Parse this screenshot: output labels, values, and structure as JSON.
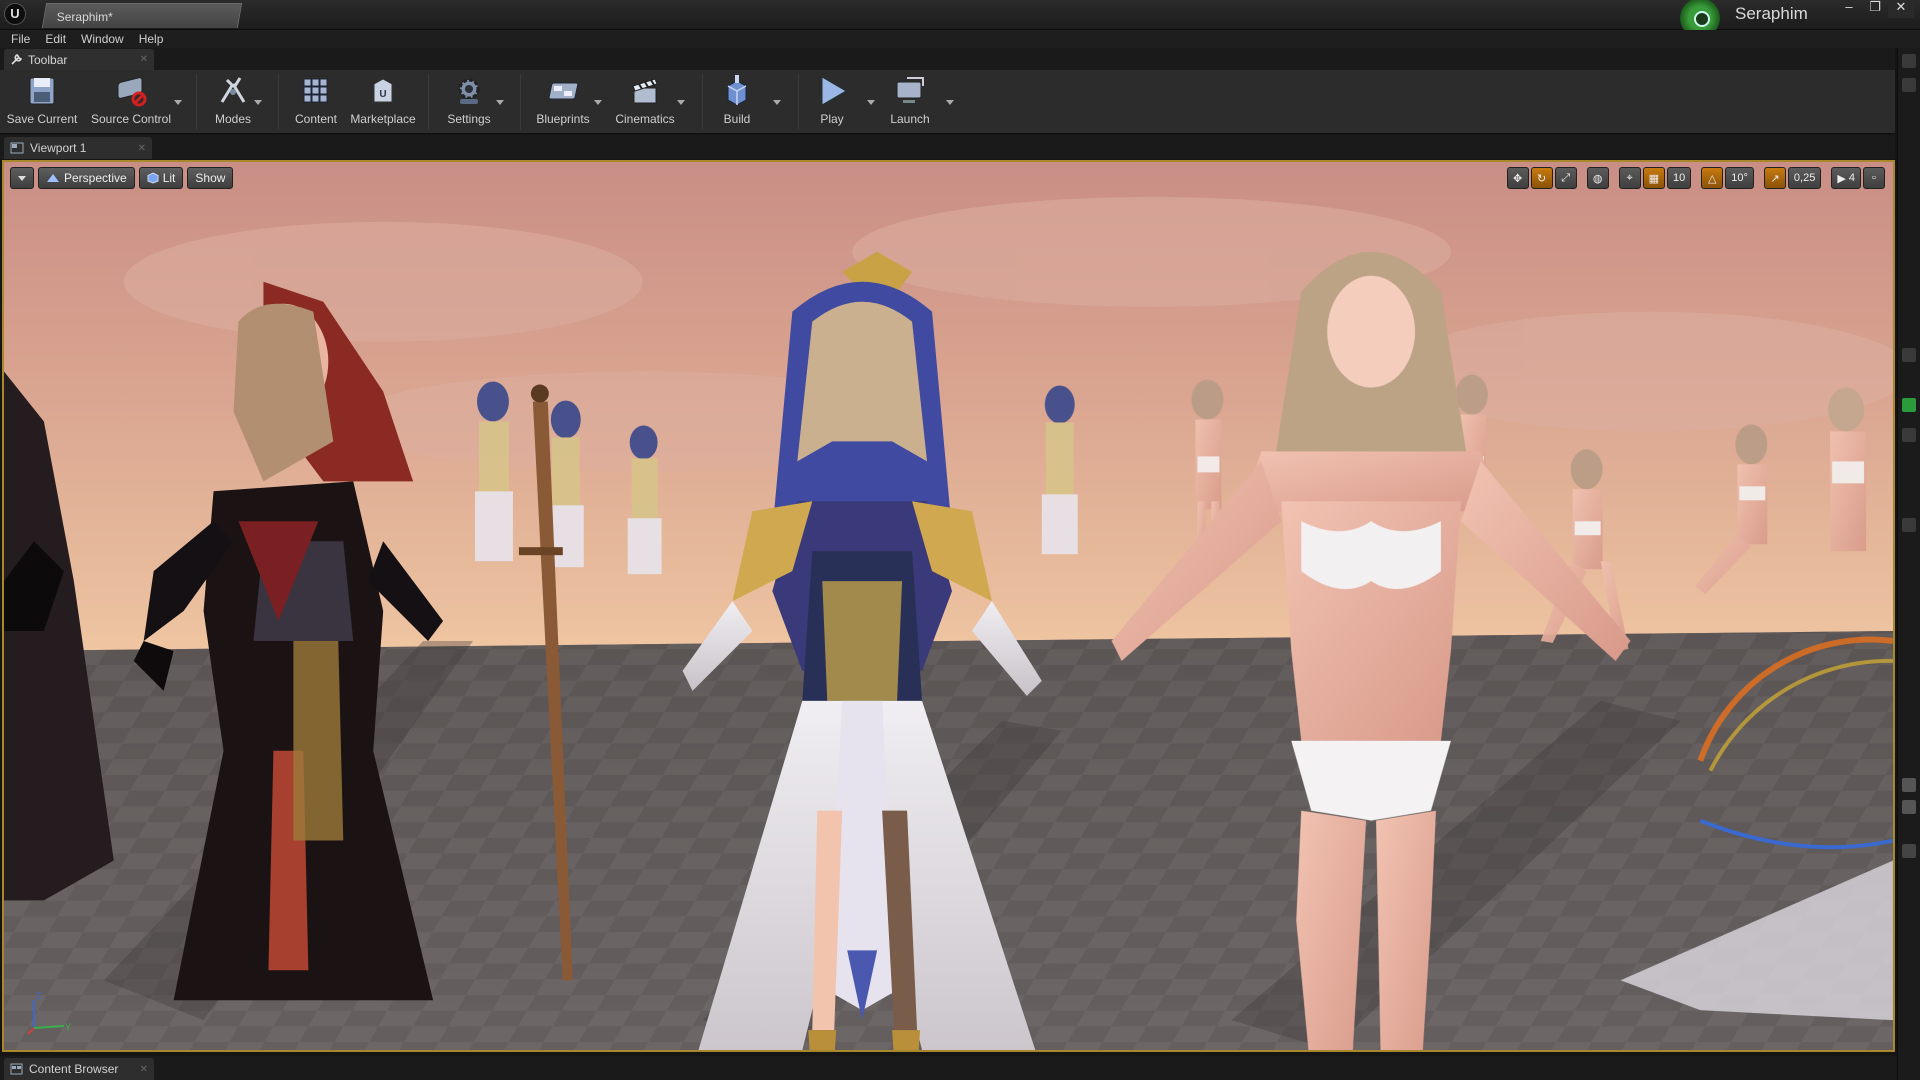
{
  "window": {
    "document_tab": "Seraphim*",
    "project_name": "Seraphim",
    "controls": [
      "–",
      "❐",
      "✕"
    ]
  },
  "menu": [
    "File",
    "Edit",
    "Window",
    "Help"
  ],
  "toolbar_panel_tab": "Toolbar",
  "toolbar": {
    "save_current": "Save Current",
    "source_control": "Source Control",
    "modes": "Modes",
    "content": "Content",
    "marketplace": "Marketplace",
    "settings": "Settings",
    "blueprints": "Blueprints",
    "cinematics": "Cinematics",
    "build": "Build",
    "play": "Play",
    "launch": "Launch"
  },
  "viewport_tab": "Viewport 1",
  "viewport": {
    "perspective": "Perspective",
    "lit": "Lit",
    "show": "Show",
    "grid_snap": "10",
    "rotation_snap": "10°",
    "scale_snap": "0,25",
    "camera_speed": "4"
  },
  "bottom_tab": "Content Browser",
  "colors": {
    "accent_orange": "#c77a10",
    "viewport_border": "#a8882a",
    "project_green": "#3a9b3a"
  }
}
